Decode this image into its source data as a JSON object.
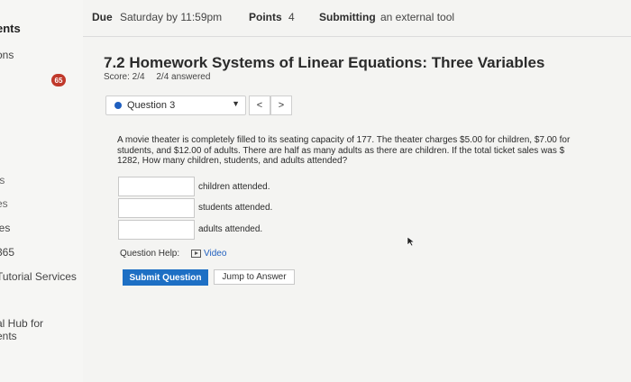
{
  "sidebar": {
    "items": [
      {
        "label": "ents",
        "style": "bold"
      },
      {
        "label": "ons",
        "style": "normal"
      },
      {
        "label": "ıs",
        "style": "light"
      },
      {
        "label": "es",
        "style": "light"
      },
      {
        "label": "les",
        "style": "normal"
      },
      {
        "label": "365",
        "style": "normal"
      },
      {
        "label": "Tutorial Services",
        "style": "normal"
      },
      {
        "label": "al Hub for",
        "style": "normal"
      },
      {
        "label": "ents",
        "style": "normal"
      }
    ],
    "badge": "65"
  },
  "header": {
    "due_label": "Due",
    "due_value": "Saturday by 11:59pm",
    "points_label": "Points",
    "points_value": "4",
    "submitting_label": "Submitting",
    "submitting_value": "an external tool"
  },
  "assignment": {
    "title": "7.2 Homework Systems of Linear Equations: Three Variables",
    "score": "Score: 2/4",
    "answered": "2/4 answered"
  },
  "question_nav": {
    "selected": "Question 3",
    "prev": "<",
    "next": ">"
  },
  "problem": {
    "text": "A movie theater is completely filled to its seating capacity of 177. The theater charges $5.00 for children, $7.00 for students, and $12.00 of adults. There are half as many adults as there are children. If the total ticket sales was $ 1282, How many children, students, and adults attended?"
  },
  "answers": [
    {
      "value": "",
      "label": "children attended."
    },
    {
      "value": "",
      "label": "students attended."
    },
    {
      "value": "",
      "label": "adults attended."
    }
  ],
  "help": {
    "label": "Question Help:",
    "video": "Video"
  },
  "buttons": {
    "submit": "Submit Question",
    "jump": "Jump to Answer"
  },
  "colors": {
    "accent": "#1d6fc4",
    "badge": "#c0392b",
    "question_dot": "#1f5fbf"
  }
}
